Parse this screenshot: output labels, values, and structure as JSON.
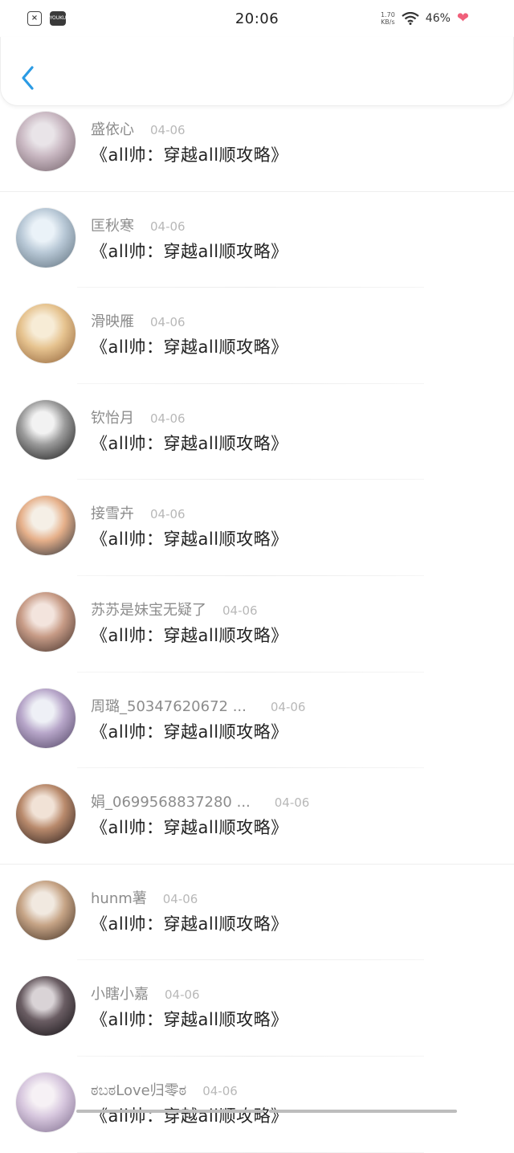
{
  "status_bar": {
    "time": "20:06",
    "speed_top": "1.70",
    "speed_unit": "KB/s",
    "battery": "46%",
    "youku_label": "YOUKU",
    "file_glyph": "×"
  },
  "list": [
    {
      "name": "盛依心",
      "date": "04-06",
      "message": "《all帅：穿越all顺攻略》",
      "avatar": [
        "#e9e4e8",
        "#c9b8c2",
        "#6f5e66"
      ]
    },
    {
      "name": "匡秋寒",
      "date": "04-06",
      "message": "《all帅：穿越all顺攻略》",
      "avatar": [
        "#eaf2f8",
        "#b8c8d6",
        "#5a6b78"
      ]
    },
    {
      "name": "滑映雁",
      "date": "04-06",
      "message": "《all帅：穿越all顺攻略》",
      "avatar": [
        "#f7ecd6",
        "#e6c38f",
        "#8a5b33"
      ]
    },
    {
      "name": "钦怡月",
      "date": "04-06",
      "message": "《all帅：穿越all顺攻略》",
      "avatar": [
        "#f2f2f2",
        "#9b9b9b",
        "#111111"
      ]
    },
    {
      "name": "接雪卉",
      "date": "04-06",
      "message": "《all帅：穿越all顺攻略》",
      "avatar": [
        "#f5efe6",
        "#e6b08a",
        "#1f2a36"
      ]
    },
    {
      "name": "苏苏是妹宝无疑了",
      "date": "04-06",
      "message": "《all帅：穿越all顺攻略》",
      "avatar": [
        "#f3e4dd",
        "#c79b86",
        "#3a2b26"
      ]
    },
    {
      "name": "周璐_50347620672 ...",
      "date": "04-06",
      "message": "《all帅：穿越all顺攻略》",
      "avatar": [
        "#eef0f6",
        "#b7a6c9",
        "#4b3f5e"
      ]
    },
    {
      "name": "娟_0699568837280 ...",
      "date": "04-06",
      "message": "《all帅：穿越all顺攻略》",
      "avatar": [
        "#f1e2d6",
        "#b98a6c",
        "#201818"
      ]
    },
    {
      "name": "hunm薯",
      "date": "04-06",
      "message": "《all帅：穿越all顺攻略》",
      "avatar": [
        "#f1e9e0",
        "#c6a486",
        "#3b2a1e"
      ]
    },
    {
      "name": "小瞎小嘉",
      "date": "04-06",
      "message": "《all帅：穿越all顺攻略》",
      "avatar": [
        "#d9d3d6",
        "#6a5d63",
        "#0f0d10"
      ]
    },
    {
      "name": "ಠಬಠLove归零ಠ",
      "date": "04-06",
      "message": "《all帅：穿越all顺攻略》",
      "avatar": [
        "#f6f1f5",
        "#d7c7de",
        "#7b6a8a"
      ]
    }
  ]
}
